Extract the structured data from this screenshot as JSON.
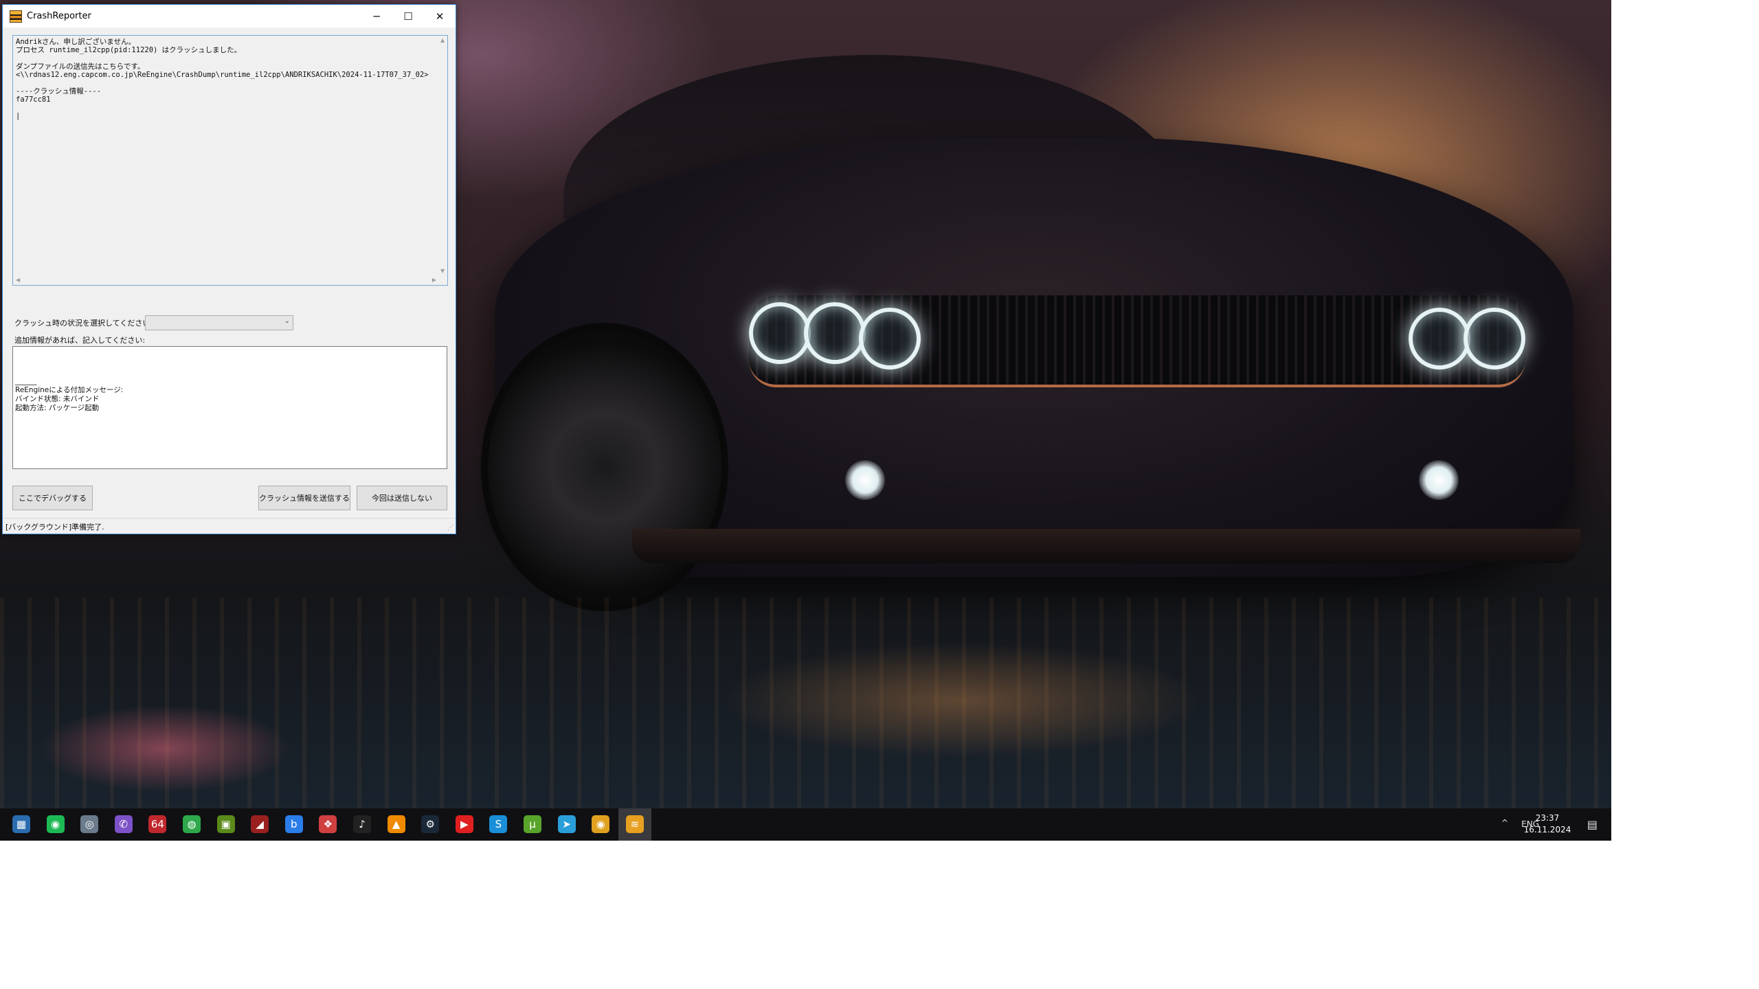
{
  "window": {
    "title": "CrashReporter",
    "minimize": "─",
    "maximize": "☐",
    "close": "✕"
  },
  "report": {
    "text": "Andrikさん、申し訳ございません。\nプロセス runtime_il2cpp(pid:11220) はクラッシュしました。\n\nダンプファイルの送信先はこちらです。\n<\\\\rdnas12.eng.capcom.co.jp\\ReEngine\\CrashDump\\runtime_il2cpp\\ANDRIKSACHIK\\2024-11-17T07_37_02>\n\n----クラッシュ情報----\nfa77cc81\n\n|"
  },
  "situation": {
    "label": "クラッシュ時の状況を選択してください:",
    "selected": ""
  },
  "additional": {
    "label": "追加情報があれば、記入してください:",
    "text": "______\nReEngineによる付加メッセージ:\nバインド状態: 未バインド\n起動方法: パッケージ起動"
  },
  "buttons": {
    "debug": "ここでデバッグする",
    "send": "クラッシュ情報を送信する",
    "dont_send": "今回は送信しない"
  },
  "status": {
    "text": "[バックグラウンド]準備完了."
  },
  "taskbar": {
    "icons": [
      {
        "name": "calculator-icon",
        "glyph": "▦",
        "color": "#2b6cb0"
      },
      {
        "name": "spotify-icon",
        "glyph": "◉",
        "color": "#1db954"
      },
      {
        "name": "chrome-beta-icon",
        "glyph": "◎",
        "color": "#6b7b8c"
      },
      {
        "name": "viber-icon",
        "glyph": "✆",
        "color": "#7d52c8"
      },
      {
        "name": "aida64-icon",
        "glyph": "64",
        "color": "#c0282d"
      },
      {
        "name": "razer-icon",
        "glyph": "◍",
        "color": "#2ea84a"
      },
      {
        "name": "nvidia-icon",
        "glyph": "▣",
        "color": "#5a8a1a"
      },
      {
        "name": "msi-afterburner-icon",
        "glyph": "◢",
        "color": "#9a2020"
      },
      {
        "name": "bing-icon",
        "glyph": "b",
        "color": "#2b7de9"
      },
      {
        "name": "photos-icon",
        "glyph": "❖",
        "color": "#d04040"
      },
      {
        "name": "tiktok-icon",
        "glyph": "♪",
        "color": "#222222"
      },
      {
        "name": "vlc-icon",
        "glyph": "▲",
        "color": "#f08a00"
      },
      {
        "name": "steam-icon",
        "glyph": "⚙",
        "color": "#1b2838"
      },
      {
        "name": "youtube-icon",
        "glyph": "▶",
        "color": "#e02020"
      },
      {
        "name": "skype-icon",
        "glyph": "S",
        "color": "#1a8fd8"
      },
      {
        "name": "utorrent-icon",
        "glyph": "µ",
        "color": "#59a42a"
      },
      {
        "name": "telegram-icon",
        "glyph": "➤",
        "color": "#2a9fd9"
      },
      {
        "name": "chrome-icon",
        "glyph": "◉",
        "color": "#e0a020"
      },
      {
        "name": "crashreporter-taskbar-icon",
        "glyph": "≋",
        "color": "#e8a020"
      }
    ],
    "tray_chevron": "^",
    "language": "ENG",
    "time": "23:37",
    "date": "16.11.2024",
    "notification": "▤"
  }
}
